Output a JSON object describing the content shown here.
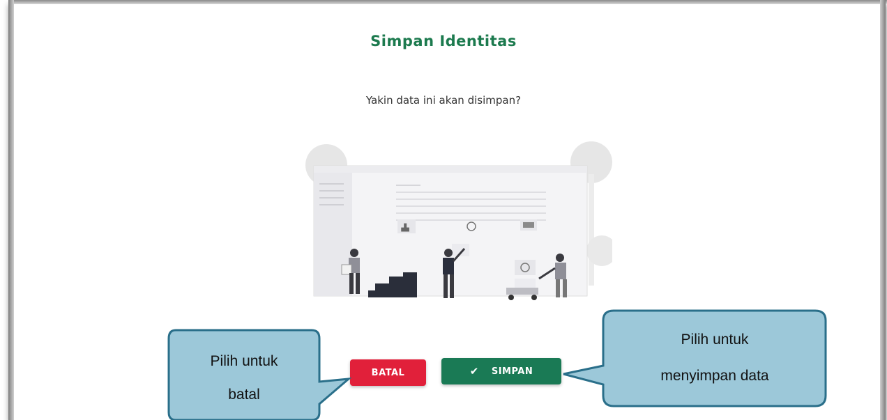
{
  "dialog": {
    "title": "Simpan Identitas",
    "message": "Yakin data ini akan disimpan?",
    "cancel_label": "BATAL",
    "save_label": "SIMPAN",
    "save_icon": "check-icon"
  },
  "callouts": {
    "left_line1": "Pilih untuk",
    "left_line2": "batal",
    "right_line1": "Pilih untuk",
    "right_line2": "menyimpan data"
  },
  "colors": {
    "title": "#1c7a4e",
    "cancel": "#e1203a",
    "save": "#1a7a55",
    "callout_fill": "#9cc8d9",
    "callout_border": "#2a6f8a"
  }
}
